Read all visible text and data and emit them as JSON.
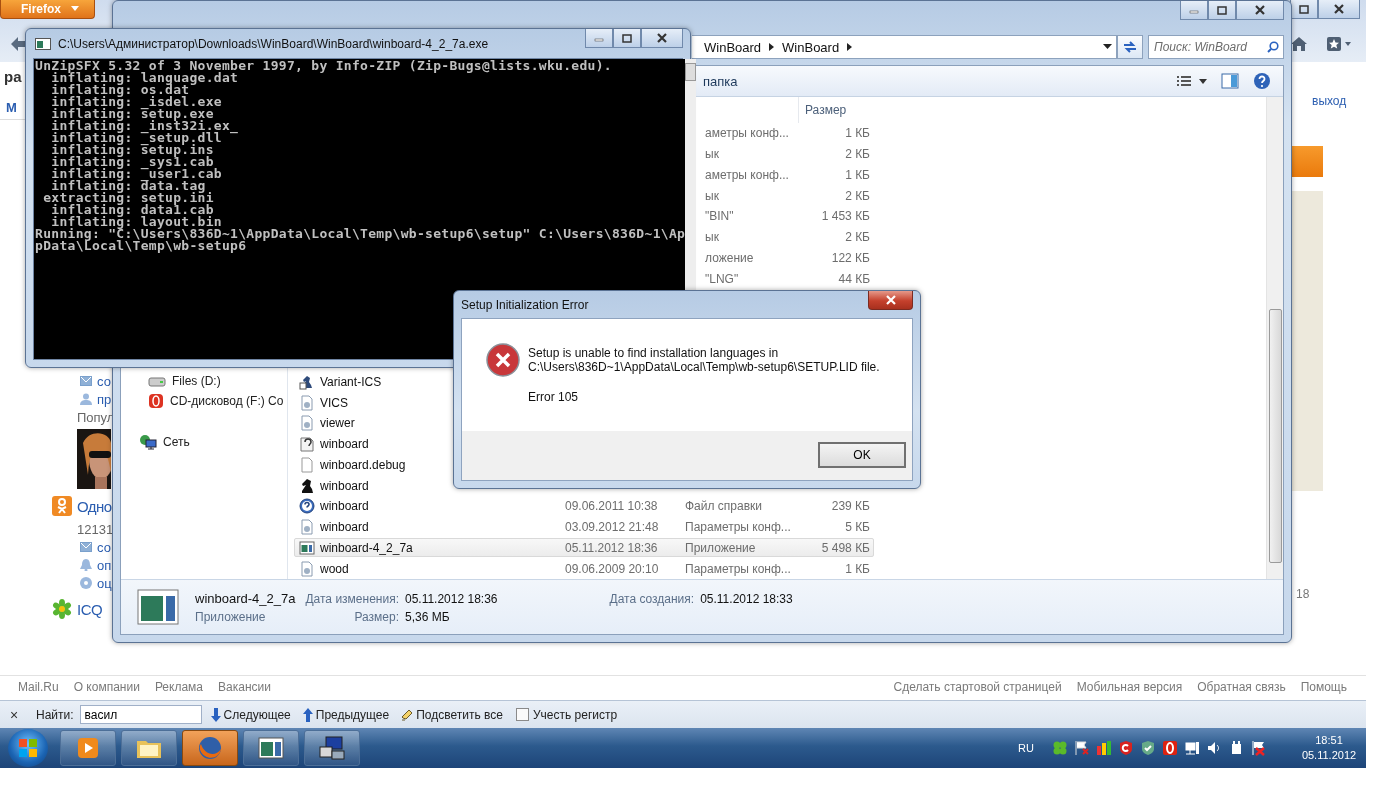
{
  "browser": {
    "menu_button": "Firefox",
    "page": {
      "heading": "ра",
      "nav_link": "М",
      "logout_link": "выход",
      "side_text": "18",
      "left_items": [
        {
          "kind": "mail",
          "text": "со"
        },
        {
          "kind": "person",
          "text": "пр"
        },
        {
          "kind": "label",
          "text": "Попул"
        },
        {
          "kind": "picture"
        },
        {
          "kind": "ok",
          "text": "Одно"
        },
        {
          "kind": "label",
          "text": "12131"
        },
        {
          "kind": "mail",
          "text": "со"
        },
        {
          "kind": "bell",
          "text": "оп"
        },
        {
          "kind": "rating",
          "text": "оц"
        },
        {
          "kind": "icq",
          "text": "ICQ"
        }
      ]
    },
    "footer": {
      "left_links": [
        "Mail.Ru",
        "О компании",
        "Реклама",
        "Вакансии"
      ],
      "right_links": [
        "Сделать стартовой страницей",
        "Мобильная версия",
        "Обратная связь",
        "Помощь"
      ]
    },
    "find_bar": {
      "close": "×",
      "label": "Найти:",
      "value": "васил",
      "next": "Следующее",
      "previous": "Предыдущее",
      "highlight": "Подсветить все",
      "match_case": {
        "label": "Учесть регистр",
        "checked": false
      }
    }
  },
  "explorer": {
    "breadcrumb": [
      "WinBoard",
      "WinBoard"
    ],
    "search_placeholder": "Поиск: WinBoard",
    "toolbar_button": "папка",
    "size_header": "Размер",
    "nav_items": [
      {
        "kind": "drive",
        "label": "Files (D:)"
      },
      {
        "kind": "cd",
        "label": "CD-дисковод (F:) Co"
      },
      {
        "kind": "network",
        "label": "Сеть"
      }
    ],
    "clipped_rows": [
      {
        "type": "аметры конф...",
        "size": "1 КБ"
      },
      {
        "type": "ык",
        "size": "2 КБ"
      },
      {
        "type": "аметры конф...",
        "size": "1 КБ"
      },
      {
        "type": "ык",
        "size": "2 КБ"
      },
      {
        "type": "\"BIN\"",
        "size": "1 453 КБ"
      },
      {
        "type": "ык",
        "size": "2 КБ"
      },
      {
        "type": "ложение",
        "size": "122 КБ"
      },
      {
        "type": "\"LNG\"",
        "size": "44 КБ"
      }
    ],
    "rows": [
      {
        "kind": "shortcut",
        "name": "Variant-ICS",
        "selected": false
      },
      {
        "kind": "config",
        "name": "VICS",
        "selected": false
      },
      {
        "kind": "config",
        "name": "viewer",
        "selected": false
      },
      {
        "kind": "setup-info",
        "name": "winboard",
        "selected": false
      },
      {
        "kind": "blank",
        "name": "winboard.debug",
        "selected": false
      },
      {
        "kind": "knight",
        "name": "winboard",
        "selected": false
      },
      {
        "kind": "help",
        "name": "winboard",
        "date": "09.06.2011 10:38",
        "type": "Файл справки",
        "size": "239 КБ",
        "selected": false
      },
      {
        "kind": "config",
        "name": "winboard",
        "date": "03.09.2012 21:48",
        "type": "Параметры конф...",
        "size": "5 КБ",
        "selected": false
      },
      {
        "kind": "app",
        "name": "winboard-4_2_7a",
        "date": "05.11.2012 18:36",
        "type": "Приложение",
        "size": "5 498 КБ",
        "selected": true
      },
      {
        "kind": "config",
        "name": "wood",
        "date": "09.06.2009 20:10",
        "type": "Параметры конф...",
        "size": "1 КБ",
        "selected": false
      }
    ],
    "details": {
      "name": "winboard-4_2_7a",
      "type": "Приложение",
      "modified_label": "Дата изменения:",
      "modified": "05.11.2012 18:36",
      "size_label": "Размер:",
      "size": "5,36 МБ",
      "created_label": "Дата создания:",
      "created": "05.11.2012 18:33"
    }
  },
  "console": {
    "title": "C:\\Users\\Администратор\\Downloads\\WinBoard\\WinBoard\\winboard-4_2_7a.exe",
    "lines": [
      "UnZipSFX 5.32 of 3 November 1997, by Info-ZIP (Zip-Bugs@lists.wku.edu).",
      "  inflating: language.dat",
      "  inflating: os.dat",
      "  inflating: _isdel.exe",
      "  inflating: setup.exe",
      "  inflating: _inst32i.ex_",
      "  inflating: _setup.dll",
      "  inflating: setup.ins",
      "  inflating: _sys1.cab",
      "  inflating: _user1.cab",
      "  inflating: data.tag",
      " extracting: setup.ini",
      "  inflating: data1.cab",
      "  inflating: layout.bin",
      "Running: \"C:\\Users\\836D~1\\AppData\\Local\\Temp\\wb-setup6\\setup\" C:\\Users\\836D~1\\Ap",
      "pData\\Local\\Temp\\wb-setup6"
    ]
  },
  "dialog": {
    "title": "Setup Initialization Error",
    "message": "Setup is unable to find installation languages in C:\\Users\\836D~1\\AppData\\Local\\Temp\\wb-setup6\\SETUP.LID file.",
    "code": "Error 105",
    "button": "OK"
  },
  "taskbar": {
    "buttons": [
      {
        "kind": "media",
        "selected": false
      },
      {
        "kind": "folder",
        "selected": false
      },
      {
        "kind": "firefox",
        "selected": true
      },
      {
        "kind": "app",
        "selected": false
      },
      {
        "kind": "setup",
        "selected": false
      }
    ],
    "language": "RU",
    "time": "18:51",
    "date": "05.11.2012"
  }
}
